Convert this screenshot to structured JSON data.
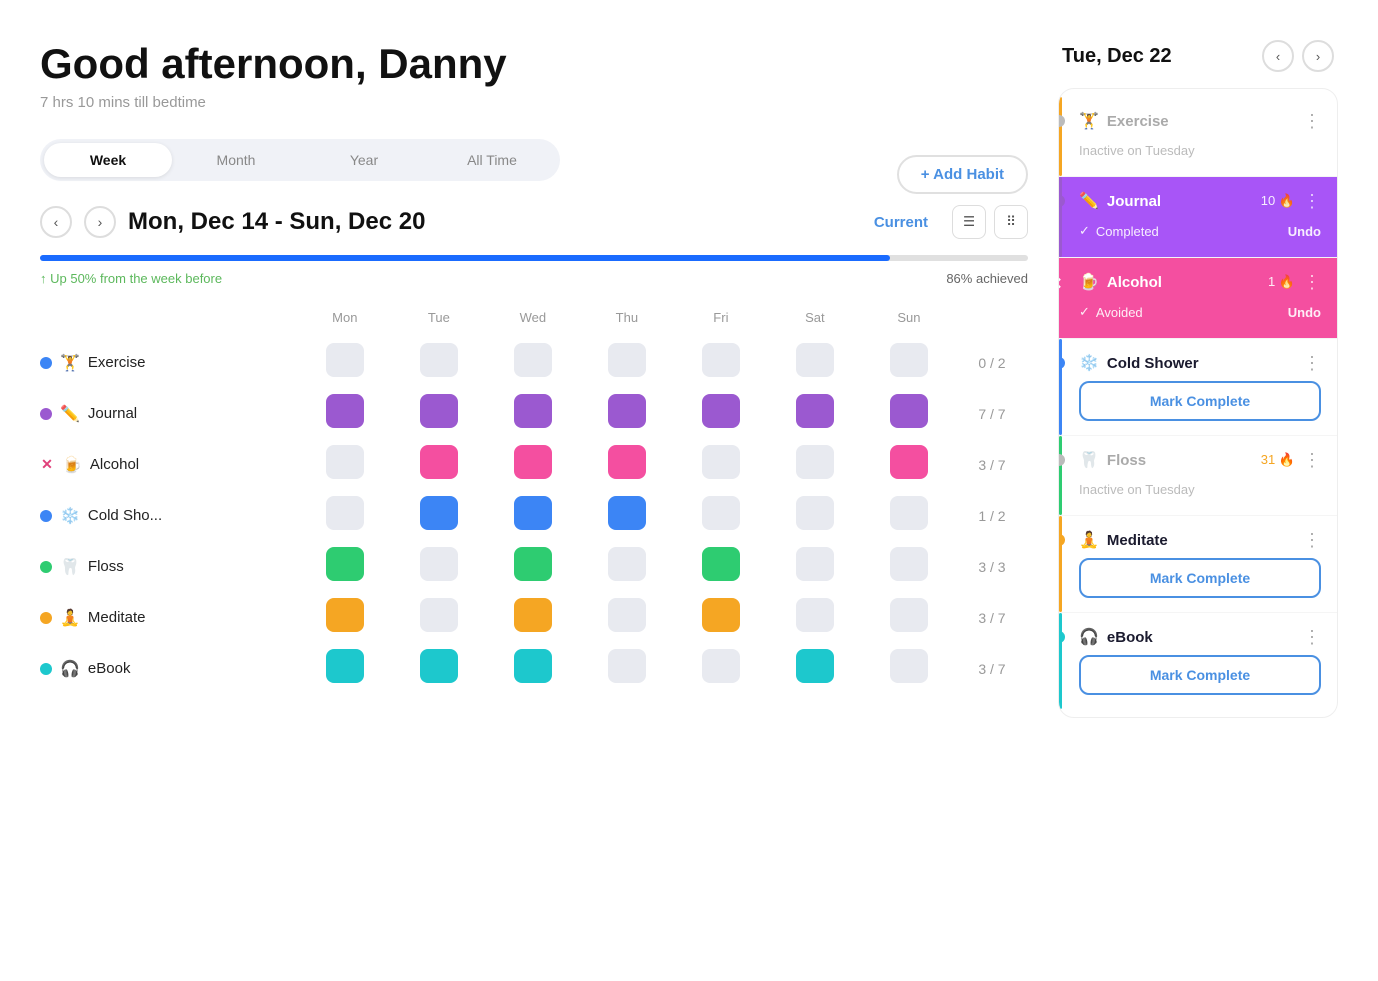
{
  "greeting": "Good afternoon, Danny",
  "subtitle": "7 hrs 10 mins till bedtime",
  "period_tabs": [
    "Week",
    "Month",
    "Year",
    "All Time"
  ],
  "active_tab": "Week",
  "add_habit_label": "+ Add Habit",
  "week_label": "Mon, Dec 14 - Sun, Dec 20",
  "current_label": "Current",
  "progress_up_label": "↑ Up 50% from the week before",
  "progress_achieved": "86% achieved",
  "progress_pct": 86,
  "days": [
    "Mon",
    "Tue",
    "Wed",
    "Thu",
    "Fri",
    "Sat",
    "Sun"
  ],
  "habits": [
    {
      "name": "Exercise",
      "icon": "🏋️",
      "dot_color": "#3c85f5",
      "type": "dot",
      "cells": [
        "empty",
        "empty",
        "empty",
        "empty_filled",
        "empty",
        "empty",
        "empty"
      ],
      "count": "0 / 2"
    },
    {
      "name": "Journal",
      "icon": "✏️",
      "dot_color": "#9b59d0",
      "type": "dot",
      "cells": [
        "purple",
        "purple",
        "purple",
        "purple",
        "purple",
        "purple",
        "purple"
      ],
      "count": "7 / 7"
    },
    {
      "name": "Alcohol",
      "icon": "🍺",
      "dot_color": "#e0407a",
      "type": "cross",
      "cells": [
        "empty",
        "pink",
        "pink",
        "pink",
        "empty",
        "empty",
        "pink",
        "empty"
      ],
      "count": "3 / 7"
    },
    {
      "name": "Cold Sho...",
      "icon": "❄️",
      "dot_color": "#3c85f5",
      "type": "dot",
      "cells": [
        "empty",
        "blue",
        "blue",
        "blue",
        "empty",
        "empty",
        "empty"
      ],
      "count": "1 / 2"
    },
    {
      "name": "Floss",
      "icon": "🦷",
      "dot_color": "#2ecc71",
      "type": "dot",
      "cells": [
        "green",
        "empty",
        "green",
        "empty",
        "green",
        "empty",
        "empty"
      ],
      "count": "3 / 3"
    },
    {
      "name": "Meditate",
      "icon": "🧘",
      "dot_color": "#f5a623",
      "type": "dot",
      "cells": [
        "orange",
        "empty",
        "orange",
        "empty",
        "orange",
        "empty",
        "empty"
      ],
      "count": "3 / 7"
    },
    {
      "name": "eBook",
      "icon": "🎧",
      "dot_color": "#1dc8cd",
      "type": "dot",
      "cells": [
        "teal",
        "teal",
        "teal",
        "empty",
        "empty",
        "teal",
        "empty"
      ],
      "count": "3 / 7"
    }
  ],
  "right_panel": {
    "date": "Tue, Dec 22",
    "habits": [
      {
        "name": "Exercise",
        "icon": "🏋️",
        "bar_color": "#f5a623",
        "dot_color": "#bbb",
        "count": null,
        "state": "inactive",
        "status_label": "Inactive on Tuesday",
        "marker": "circle"
      },
      {
        "name": "Journal",
        "icon": "✏️",
        "bar_color": "#9b59d0",
        "dot_color": "#9b59d0",
        "count": "10",
        "state": "completed",
        "status_label": "Completed",
        "undo_label": "Undo",
        "marker": "circle",
        "bg": "completed-bg"
      },
      {
        "name": "Alcohol",
        "icon": "🍺",
        "bar_color": "#f44fa0",
        "dot_color": "#f44fa0",
        "count": "1",
        "state": "avoided",
        "status_label": "Avoided",
        "undo_label": "Undo",
        "marker": "cross",
        "bg": "avoided-bg"
      },
      {
        "name": "Cold Shower",
        "icon": "❄️",
        "bar_color": "#3c85f5",
        "dot_color": "#3c85f5",
        "count": null,
        "state": "mark",
        "mark_label": "Mark Complete",
        "marker": "circle"
      },
      {
        "name": "Floss",
        "icon": "🦷",
        "bar_color": "#2ecc71",
        "dot_color": "#bbb",
        "count": "31",
        "state": "inactive",
        "status_label": "Inactive on Tuesday",
        "marker": "circle"
      },
      {
        "name": "Meditate",
        "icon": "🧘",
        "bar_color": "#f5a623",
        "dot_color": "#f5a623",
        "count": null,
        "state": "mark",
        "mark_label": "Mark Complete",
        "marker": "circle"
      },
      {
        "name": "eBook",
        "icon": "🎧",
        "bar_color": "#1dc8cd",
        "dot_color": "#1dc8cd",
        "count": null,
        "state": "mark",
        "mark_label": "Mark Complete",
        "marker": "circle"
      }
    ]
  }
}
